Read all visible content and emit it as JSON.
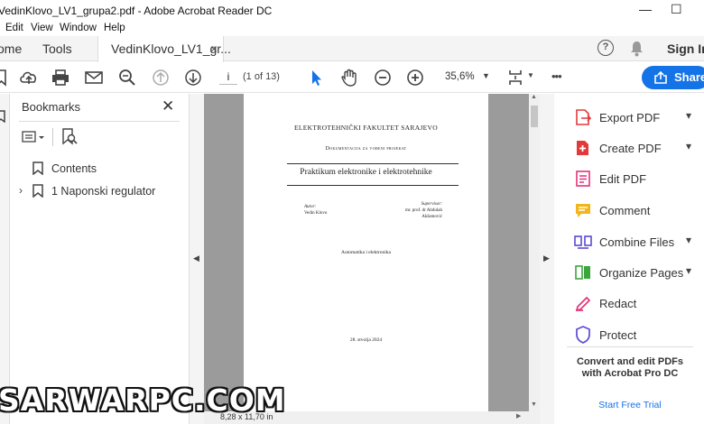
{
  "window": {
    "title": "VedinKlovo_LV1_grupa2.pdf - Adobe Acrobat Reader DC",
    "minimize": "—",
    "maximize": "☐"
  },
  "menu": [
    "Edit",
    "View",
    "Window",
    "Help"
  ],
  "tabs": {
    "home": "ome",
    "tools": "Tools",
    "document": "VedinKlovo_LV1_gr...",
    "close": "×"
  },
  "header_right": {
    "help_icon": "?",
    "signin": "Sign In"
  },
  "toolbar": {
    "page_current": "i",
    "page_count": "(1 of 13)",
    "zoom": "35,6%",
    "more": "•••",
    "share": "Share"
  },
  "bookmarks": {
    "title": "Bookmarks",
    "close": "✕",
    "items": [
      {
        "label": "Contents",
        "expandable": false
      },
      {
        "label": "1 Naponski regulator",
        "expandable": true
      }
    ]
  },
  "document_page": {
    "university": "ELEKTROTEHNIČKI FAKULTET SARAJEVO",
    "doc_type": "Dokumentacija za vođeni projekat",
    "title": "Praktikum elektronike i elektrotehnike",
    "author_label": "Autor:",
    "author_name": "Vedin Klovo",
    "supervisor_label": "Supervisor:",
    "supervisor_line1": "mr. prof. dr Abdulah",
    "supervisor_line2": "Akšamović",
    "department": "Automatika i elektronika",
    "date": "28. stvolja 2024"
  },
  "status": {
    "page_size": "8,28 x 11,70 in"
  },
  "tools_panel": {
    "items": [
      {
        "label": "Export PDF",
        "has_menu": true,
        "color": "#e23a3a",
        "icon": "export-pdf-icon"
      },
      {
        "label": "Create PDF",
        "has_menu": true,
        "color": "#e23a3a",
        "icon": "create-pdf-icon"
      },
      {
        "label": "Edit PDF",
        "has_menu": false,
        "color": "#e2347a",
        "icon": "edit-pdf-icon"
      },
      {
        "label": "Comment",
        "has_menu": false,
        "color": "#f2b51c",
        "icon": "comment-icon"
      },
      {
        "label": "Combine Files",
        "has_menu": true,
        "color": "#5a4bd6",
        "icon": "combine-files-icon"
      },
      {
        "label": "Organize Pages",
        "has_menu": true,
        "color": "#3da53d",
        "icon": "organize-pages-icon"
      },
      {
        "label": "Redact",
        "has_menu": false,
        "color": "#e2347a",
        "icon": "redact-icon"
      },
      {
        "label": "Protect",
        "has_menu": false,
        "color": "#5a4bd6",
        "icon": "protect-icon"
      }
    ],
    "promo": "Convert and edit PDFs with Acrobat Pro DC",
    "promo_link": "Start Free Trial"
  },
  "watermark": "SARWARPC.COM",
  "colors": {
    "accent": "#1473e6",
    "doc_background": "#9b9b9b"
  }
}
